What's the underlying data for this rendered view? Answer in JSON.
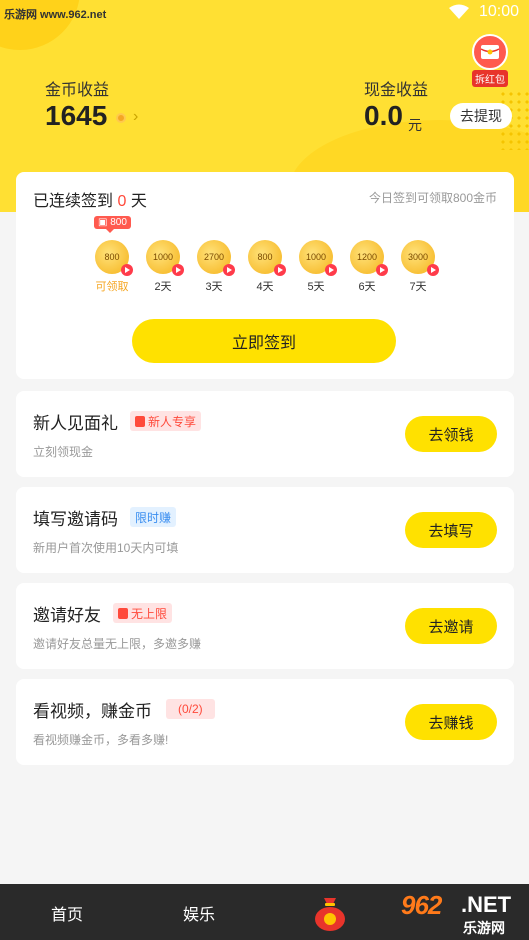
{
  "status_bar": {
    "watermark": "乐游网 www.962.net",
    "time": "10:00"
  },
  "header": {
    "redpack_label": "拆红包",
    "coin": {
      "label": "金币收益",
      "value": "1645"
    },
    "cash": {
      "label": "现金收益",
      "value": "0.0",
      "unit": "元",
      "button": "去提现"
    }
  },
  "signin": {
    "prefix": "已连续签到",
    "count": "0",
    "suffix": "天",
    "hint": "今日签到可领取800金币",
    "bubble": "800",
    "days": [
      {
        "amount": "800",
        "label": "可领取"
      },
      {
        "amount": "1000",
        "label": "2天"
      },
      {
        "amount": "2700",
        "label": "3天"
      },
      {
        "amount": "800",
        "label": "4天"
      },
      {
        "amount": "1000",
        "label": "5天"
      },
      {
        "amount": "1200",
        "label": "6天"
      },
      {
        "amount": "3000",
        "label": "7天"
      }
    ],
    "button": "立即签到"
  },
  "tasks": [
    {
      "title": "新人见面礼",
      "tag": "新人专享",
      "desc": "立刻领现金",
      "button": "去领钱"
    },
    {
      "title": "填写邀请码",
      "tag": "限时赚",
      "desc": "新用户首次使用10天内可填",
      "button": "去填写"
    },
    {
      "title": "邀请好友",
      "tag": "无上限",
      "desc": "邀请好友总量无上限，多邀多赚",
      "button": "去邀请"
    },
    {
      "title": "看视频，赚金币",
      "tag": "(0/2)",
      "desc": "看视频赚金币，多看多赚!",
      "button": "去赚钱"
    }
  ],
  "nav": {
    "home": "首页",
    "fun": "娱乐"
  },
  "brand": {
    "num": "962",
    "net": ".NET",
    "sub": "乐游网"
  },
  "colors": {
    "yellow": "#ffe033",
    "button_yellow": "#ffe100",
    "red": "#ff4a3b"
  }
}
